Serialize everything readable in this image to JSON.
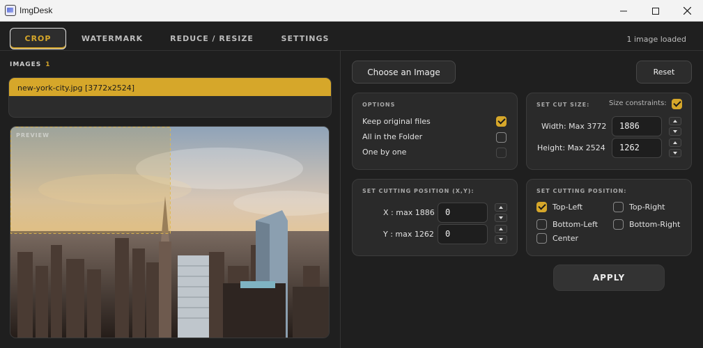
{
  "window": {
    "title": "ImgDesk"
  },
  "tabs": [
    {
      "label": "CROP",
      "active": true
    },
    {
      "label": "WATERMARK"
    },
    {
      "label": "REDUCE / RESIZE"
    },
    {
      "label": "SETTINGS"
    }
  ],
  "status": {
    "images_loaded": "1 image loaded"
  },
  "images": {
    "label": "IMAGES",
    "count": "1",
    "files": [
      {
        "name": "new-york-city.jpg [3772x2524]",
        "selected": true
      }
    ]
  },
  "preview": {
    "label": "PREVIEW",
    "crop_fraction_x": 0.5,
    "crop_fraction_y": 0.5
  },
  "buttons": {
    "choose_image": "Choose an Image",
    "reset": "Reset",
    "apply": "APPLY"
  },
  "options": {
    "title": "OPTIONS",
    "items": [
      {
        "label": "Keep original files",
        "checked": true
      },
      {
        "label": "All in the Folder",
        "checked": false
      },
      {
        "label": "One by one",
        "checked": false,
        "disabled": true
      }
    ]
  },
  "cut_size": {
    "title": "SET CUT SIZE:",
    "constraints_label": "Size constraints:",
    "constraints_checked": true,
    "width_label": "Width: Max 3772",
    "width_value": "1886",
    "height_label": "Height: Max 2524",
    "height_value": "1262"
  },
  "cut_position_xy": {
    "title": "SET CUTTING POSITION (X,Y):",
    "x_label": "X : max 1886",
    "x_value": "0",
    "y_label": "Y : max 1262",
    "y_value": "0"
  },
  "cut_position": {
    "title": "SET CUTTING POSITION:",
    "options": [
      {
        "label": "Top-Left",
        "checked": true
      },
      {
        "label": "Top-Right",
        "checked": false
      },
      {
        "label": "Bottom-Left",
        "checked": false
      },
      {
        "label": "Bottom-Right",
        "checked": false
      },
      {
        "label": "Center",
        "checked": false
      }
    ]
  },
  "colors": {
    "accent": "#d6a72a",
    "background": "#1f1f1f",
    "panel": "#2a2a2a"
  }
}
